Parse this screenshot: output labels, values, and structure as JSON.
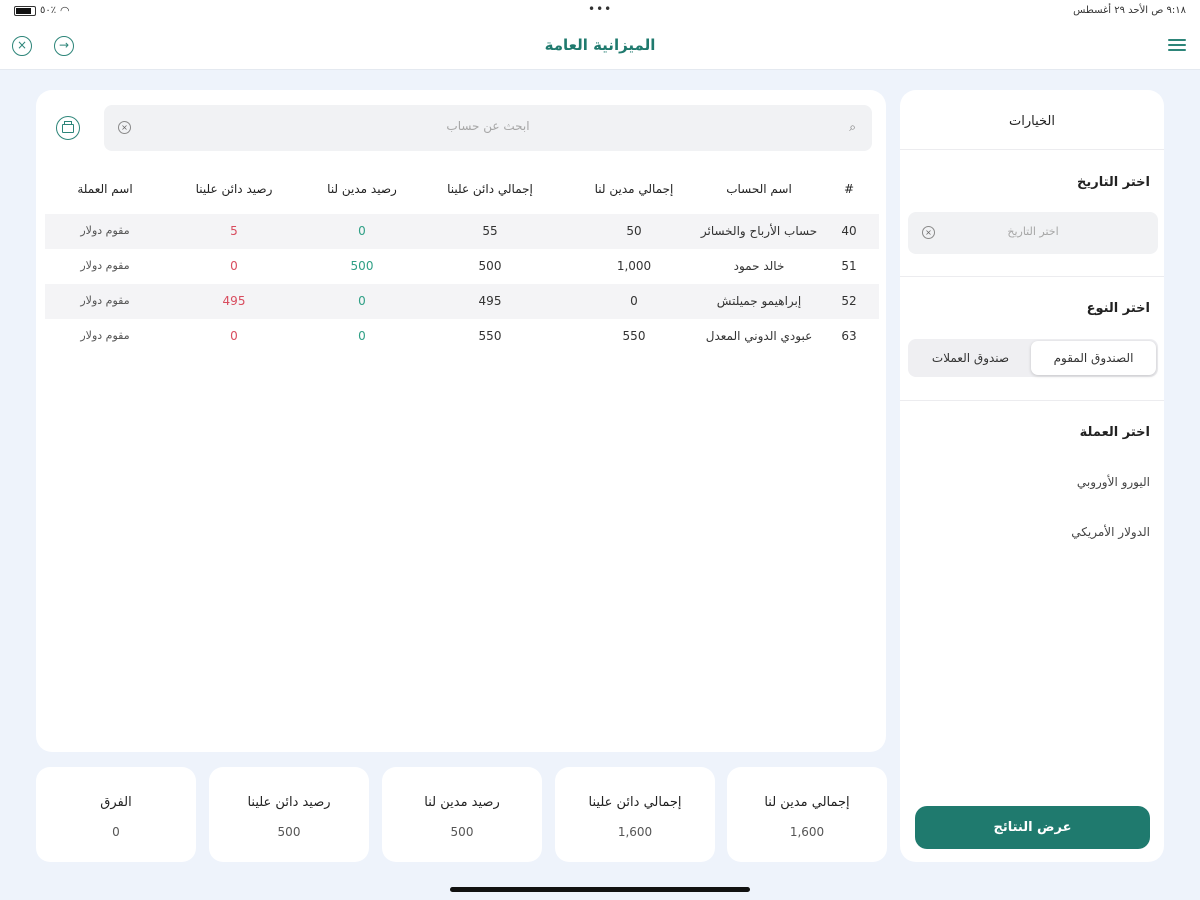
{
  "status_bar": {
    "battery": "٥٠٪",
    "datetime": "٩:١٨ ص   الأحد ٢٩ أغسطس",
    "dots": "•••"
  },
  "header": {
    "title": "الميزانية العامة",
    "close_icon": "×",
    "next_icon": "→"
  },
  "search": {
    "placeholder": "ابحث عن حساب",
    "clear_icon": "×",
    "search_icon": "⌕"
  },
  "table": {
    "headers": {
      "num": "#",
      "name": "اسم الحساب",
      "total_debit": "إجمالي مدين لنا",
      "total_credit": "إجمالي دائن علينا",
      "debit_balance": "رصيد مدين لنا",
      "credit_balance": "رصيد دائن علينا",
      "currency": "اسم العملة"
    },
    "rows": [
      {
        "num": "40",
        "name": "حساب الأرباح والخسائر",
        "total_debit": "50",
        "total_credit": "55",
        "debit_balance": "0",
        "credit_balance": "5",
        "currency": "مقوم دولار"
      },
      {
        "num": "51",
        "name": "خالد حمود",
        "total_debit": "1,000",
        "total_credit": "500",
        "debit_balance": "500",
        "credit_balance": "0",
        "currency": "مقوم دولار"
      },
      {
        "num": "52",
        "name": "إبراهيمو جميلتش",
        "total_debit": "0",
        "total_credit": "495",
        "debit_balance": "0",
        "credit_balance": "495",
        "currency": "مقوم دولار"
      },
      {
        "num": "63",
        "name": "عبودي الدوني المعدل",
        "total_debit": "550",
        "total_credit": "550",
        "debit_balance": "0",
        "credit_balance": "0",
        "currency": "مقوم دولار"
      }
    ]
  },
  "summary": {
    "total_debit": {
      "label": "إجمالي مدين لنا",
      "value": "1,600"
    },
    "total_credit": {
      "label": "إجمالي دائن علينا",
      "value": "1,600"
    },
    "debit_balance": {
      "label": "رصيد مدين لنا",
      "value": "500"
    },
    "credit_balance": {
      "label": "رصيد دائن علينا",
      "value": "500"
    },
    "difference": {
      "label": "الفرق",
      "value": "0"
    }
  },
  "side_panel": {
    "title": "الخيارات",
    "date_section": "اختر التاريخ",
    "date_placeholder": "اختر التاريخ",
    "type_section": "اختر النوع",
    "type_options": {
      "selected": "الصندوق المقوم",
      "other": "صندوق العملات"
    },
    "currency_section": "اختر العملة",
    "currencies": [
      "اليورو الأوروبي",
      "الدولار الأمريكي"
    ],
    "show_button": "عرض النتائج"
  },
  "colors": {
    "accent": "#1f7a6e",
    "positive": "#2e9f85",
    "negative": "#d84c5e"
  }
}
